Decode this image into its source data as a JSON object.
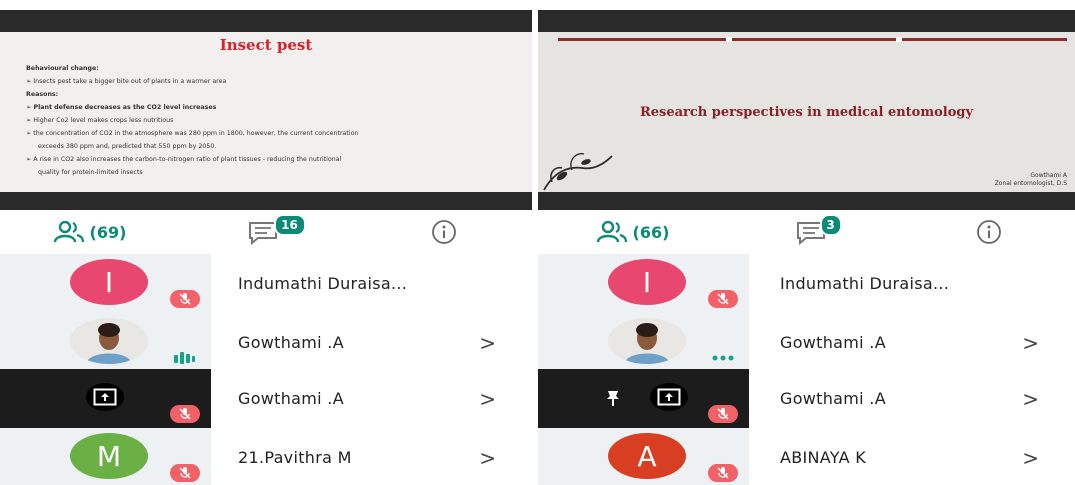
{
  "left": {
    "slide": {
      "title": "Insect pest",
      "lines": [
        "Behavioural change:",
        "Insects pest take a bigger bite out of plants in a warmer area",
        "Reasons:",
        "Plant defense decreases as the CO2 level increases",
        "Higher Co2 level makes crops less nutritious",
        "the concentration of CO2 in the atmosphere was 280 ppm in 1800, however, the current concentration",
        "exceeds 380 ppm and, predicted that 550 ppm by 2050.",
        "A rise in CO2 also increases the carbon-to-nitrogen ratio of plant tissues - reducing the nutritional",
        "quality for protein-limited insects"
      ]
    },
    "tabs": {
      "participants_count": "(69)",
      "chat_badge": "16"
    },
    "participants": [
      {
        "initial": "I",
        "name": "Indumathi Duraisa...",
        "color": "#e8476f",
        "status": "muted"
      },
      {
        "initial": "",
        "name": "Gowthami .A",
        "status": "speaking"
      },
      {
        "initial": "",
        "name": "Gowthami .A",
        "status": "muted"
      },
      {
        "initial": "M",
        "name": "21.Pavithra M",
        "color": "#6bb045",
        "status": "muted"
      }
    ]
  },
  "right": {
    "slide": {
      "title": "Research perspectives in medical entomology",
      "author_line1": "Gowthami A",
      "author_line2": "Zonal entomologist, D.S"
    },
    "tabs": {
      "participants_count": "(66)",
      "chat_badge": "3"
    },
    "participants": [
      {
        "initial": "I",
        "name": "Indumathi Duraisa...",
        "color": "#e8476f",
        "status": "muted"
      },
      {
        "initial": "",
        "name": "Gowthami .A",
        "status": "typing"
      },
      {
        "initial": "",
        "name": "Gowthami .A",
        "status": "muted"
      },
      {
        "initial": "A",
        "name": "ABINAYA K",
        "color": "#d83e22",
        "status": "muted"
      }
    ]
  },
  "chevron": ">",
  "icons": [
    "people-icon",
    "chat-icon",
    "info-icon",
    "mic-off-icon",
    "screen-share-icon",
    "pin-icon",
    "speaking-icon",
    "chevron-right-icon"
  ],
  "colors": {
    "accent": "#0b8a78",
    "mute": "#f26068",
    "slide_title_left": "#d8232a",
    "slide_title_right": "#8a1f24"
  }
}
